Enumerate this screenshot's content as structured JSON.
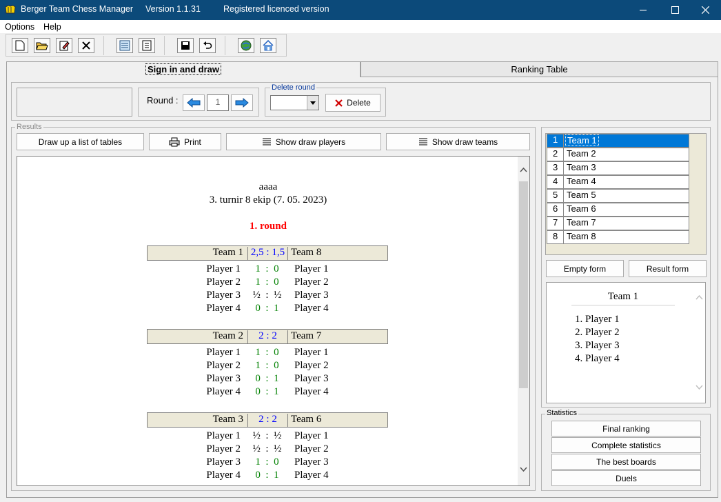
{
  "titlebar": {
    "app_name": "Berger Team Chess Manager",
    "version": "Version 1.1.31",
    "license": "Registered licenced version",
    "minimize": "–",
    "maximize": "☐",
    "close": "✕"
  },
  "menu": {
    "options": "Options",
    "help": "Help"
  },
  "tabs": {
    "sign_in": "Sign in and draw",
    "ranking": "Ranking Table"
  },
  "round": {
    "label": "Round :",
    "value": "1"
  },
  "delete_round": {
    "legend": "Delete round",
    "select_value": "",
    "button": "Delete"
  },
  "results": {
    "legend": "Results",
    "buttons": {
      "draw_list": "Draw up a list of tables",
      "print": "Print",
      "show_players": "Show draw players",
      "show_teams": "Show draw teams"
    }
  },
  "report": {
    "title": "aaaa",
    "subtitle": "3. turnir 8 ekip (7. 05. 2023)",
    "round_heading": "1. round",
    "matches": [
      {
        "home": "Team 1",
        "score": "2,5 : 1,5",
        "away": "Team 8",
        "rows": [
          {
            "p1": "Player 1",
            "res": "1  :  0",
            "p2": "Player 1",
            "half": false
          },
          {
            "p1": "Player 2",
            "res": "1  :  0",
            "p2": "Player 2",
            "half": false
          },
          {
            "p1": "Player 3",
            "res": "½  :  ½",
            "p2": "Player 3",
            "half": true
          },
          {
            "p1": "Player 4",
            "res": "0  :  1",
            "p2": "Player 4",
            "half": false
          }
        ]
      },
      {
        "home": "Team 2",
        "score": "2 : 2",
        "away": "Team 7",
        "rows": [
          {
            "p1": "Player 1",
            "res": "1  :  0",
            "p2": "Player 1",
            "half": false
          },
          {
            "p1": "Player 2",
            "res": "1  :  0",
            "p2": "Player 2",
            "half": false
          },
          {
            "p1": "Player 3",
            "res": "0  :  1",
            "p2": "Player 3",
            "half": false
          },
          {
            "p1": "Player 4",
            "res": "0  :  1",
            "p2": "Player 4",
            "half": false
          }
        ]
      },
      {
        "home": "Team 3",
        "score": "2 : 2",
        "away": "Team 6",
        "rows": [
          {
            "p1": "Player 1",
            "res": "½  :  ½",
            "p2": "Player 1",
            "half": true
          },
          {
            "p1": "Player 2",
            "res": "½  :  ½",
            "p2": "Player 2",
            "half": true
          },
          {
            "p1": "Player 3",
            "res": "1  :  0",
            "p2": "Player 3",
            "half": false
          },
          {
            "p1": "Player 4",
            "res": "0  :  1",
            "p2": "Player 4",
            "half": false
          }
        ]
      }
    ]
  },
  "teams": [
    {
      "n": "1",
      "name": "Team 1"
    },
    {
      "n": "2",
      "name": "Team 2"
    },
    {
      "n": "3",
      "name": "Team 3"
    },
    {
      "n": "4",
      "name": "Team 4"
    },
    {
      "n": "5",
      "name": "Team 5"
    },
    {
      "n": "6",
      "name": "Team 6"
    },
    {
      "n": "7",
      "name": "Team 7"
    },
    {
      "n": "8",
      "name": "Team 8"
    }
  ],
  "forms": {
    "empty": "Empty form",
    "result": "Result form"
  },
  "team_detail": {
    "name": "Team 1",
    "players": [
      "1. Player 1",
      "2. Player 2",
      "3. Player 3",
      "4. Player 4"
    ]
  },
  "statistics": {
    "legend": "Statistics",
    "buttons": [
      "Final ranking",
      "Complete statistics",
      "The best boards",
      "Duels"
    ]
  },
  "colors": {
    "titlebar": "#0c4a7a",
    "selected": "#0078d7",
    "round_heading": "#ff0000",
    "score": "#0000ff",
    "result": "#008000"
  }
}
